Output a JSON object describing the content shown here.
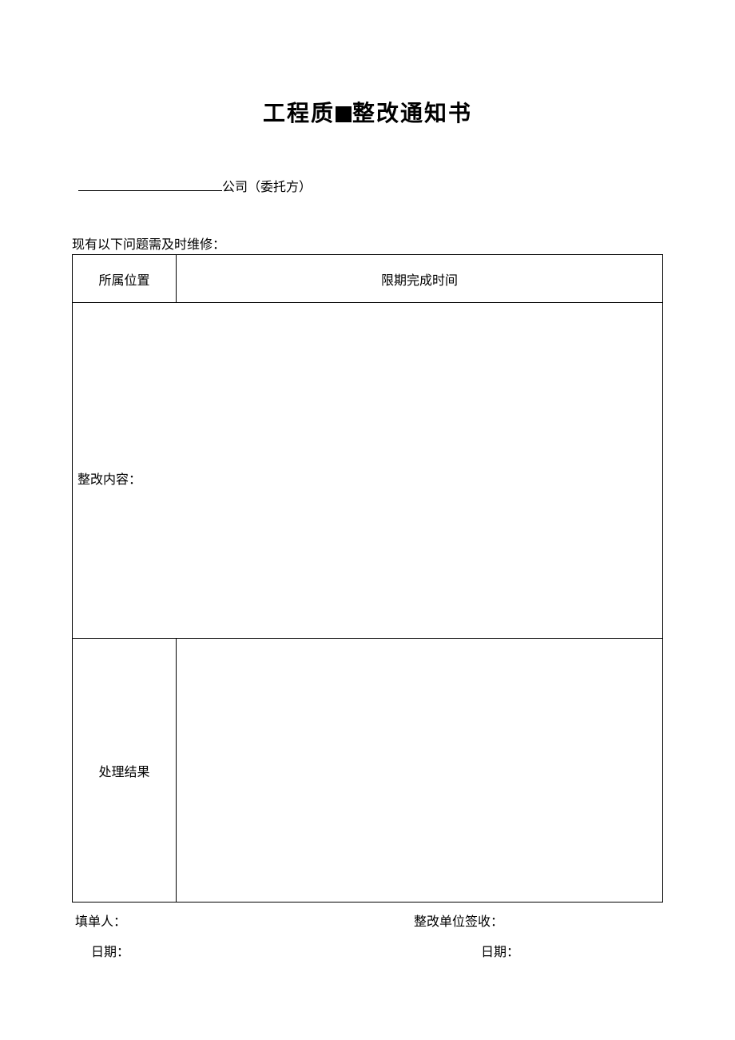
{
  "title": {
    "part1": "工程质",
    "part2": "整改通知书"
  },
  "company_line": {
    "suffix": "公司（委托方）"
  },
  "intro": "现有以下问题需及时维修：",
  "table": {
    "col_location": "所属位置",
    "col_deadline": "限期完成时间",
    "content_label": "整改内容：",
    "result_label": "处理结果"
  },
  "footer": {
    "filler_label": "填单人：",
    "signer_label": "整改单位签收：",
    "date_label_left": "日期：",
    "date_label_right": "日期："
  }
}
